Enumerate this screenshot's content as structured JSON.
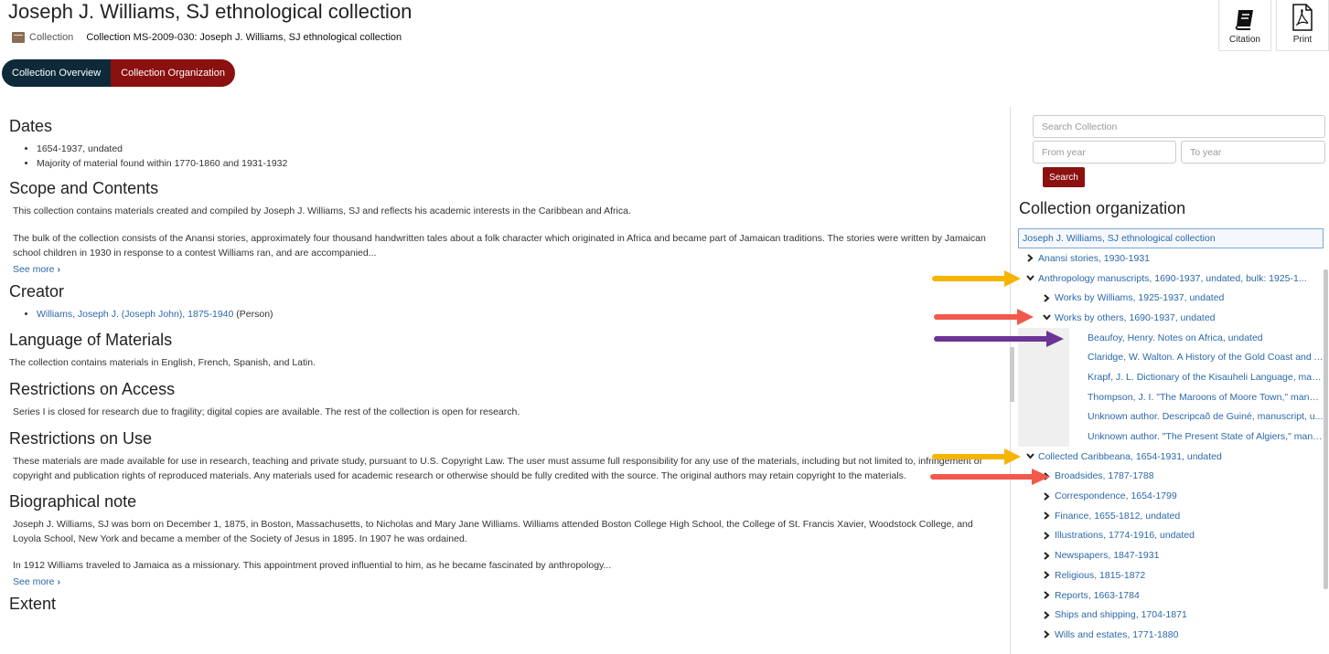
{
  "header": {
    "title": "Joseph J. Williams, SJ ethnological collection",
    "breadcrumb_type": "Collection",
    "breadcrumb_id": "Collection MS-2009-030: Joseph J. Williams, SJ ethnological collection",
    "citation_label": "Citation",
    "print_label": "Print"
  },
  "tabs": [
    "Collection Overview",
    "Collection Organization"
  ],
  "main": {
    "dates_h": "Dates",
    "dates": [
      "1654-1937, undated",
      "Majority of material found within 1770-1860 and 1931-1932"
    ],
    "scope_h": "Scope and Contents",
    "scope_p1": "This collection contains materials created and compiled by Joseph J. Williams, SJ and reflects his academic interests in the Caribbean and Africa.",
    "scope_p2": "The bulk of the collection consists of the Anansi stories, approximately four thousand handwritten tales about a folk character which originated in Africa and became part of Jamaican traditions. The stories were written by Jamaican school children in 1930 in response to a contest Williams ran, and are accompanied...",
    "see_more": "See more",
    "creator_h": "Creator",
    "creator_link": "Williams, Joseph J. (Joseph John), 1875-1940",
    "creator_role": "(Person)",
    "lang_h": "Language of Materials",
    "lang_p": "The collection contains materials in English, French, Spanish, and Latin.",
    "access_h": "Restrictions on Access",
    "access_p": "Series I is closed for research due to fragility; digital copies are available. The rest of the collection is open for research.",
    "use_h": "Restrictions on Use",
    "use_p": "These materials are made available for use in research, teaching and private study, pursuant to U.S. Copyright Law. The user must assume full responsibility for any use of the materials, including but not limited to, infringement of copyright and publication rights of reproduced materials. Any materials used for academic research or otherwise should be fully credited with the source. The original authors may retain copyright to the materials.",
    "bio_h": "Biographical note",
    "bio_p1": "Joseph J. Williams, SJ was born on December 1, 1875, in Boston, Massachusetts, to Nicholas and Mary Jane Williams. Williams attended Boston College High School, the College of St. Francis Xavier, Woodstock College, and Loyola School, New York and became a member of the Society of Jesus in 1895. In 1907 he was ordained.",
    "bio_p2": "In 1912 Williams traveled to Jamaica as a missionary. This appointment proved influential to him, as he became fascinated by anthropology...",
    "extent_h": "Extent"
  },
  "sidebar": {
    "search_placeholder": "Search Collection",
    "from_placeholder": "From year",
    "to_placeholder": "To year",
    "search_button": "Search",
    "org_heading": "Collection organization",
    "tree": [
      {
        "label": "Joseph J. Williams, SJ ethnological collection",
        "level": 0,
        "chev": ""
      },
      {
        "label": "Anansi stories, 1930-1931",
        "level": 1,
        "chev": "›"
      },
      {
        "label": "Anthropology manuscripts, 1690-1937, undated, bulk: 1925-1...",
        "level": 1,
        "chev": "⌄"
      },
      {
        "label": "Works by Williams, 1925-1937, undated",
        "level": 2,
        "chev": "›"
      },
      {
        "label": "Works by others, 1690-1937, undated",
        "level": 2,
        "chev": "⌄"
      },
      {
        "label": "Beaufoy, Henry. Notes on Africa, undated",
        "level": 3,
        "chev": ""
      },
      {
        "label": "Claridge, W. Walton. A History of the Gold Coast and A...",
        "level": 3,
        "chev": ""
      },
      {
        "label": "Krapf, J. L. Dictionary of the Kisauheli Language, manu...",
        "level": 3,
        "chev": ""
      },
      {
        "label": "Thompson, J. I. \"The Maroons of Moore Town,\" manus...",
        "level": 3,
        "chev": ""
      },
      {
        "label": "Unknown author. Descripcaõ de Guiné, manuscript, u...",
        "level": 3,
        "chev": ""
      },
      {
        "label": "Unknown author. \"The Present State of Algiers,\" manu...",
        "level": 3,
        "chev": ""
      },
      {
        "label": "Collected Caribbeana, 1654-1931, undated",
        "level": 1,
        "chev": "⌄"
      },
      {
        "label": "Broadsides, 1787-1788",
        "level": 2,
        "chev": "›"
      },
      {
        "label": "Correspondence, 1654-1799",
        "level": 2,
        "chev": "›"
      },
      {
        "label": "Finance, 1655-1812, undated",
        "level": 2,
        "chev": "›"
      },
      {
        "label": "Illustrations, 1774-1916, undated",
        "level": 2,
        "chev": "›"
      },
      {
        "label": "Newspapers, 1847-1931",
        "level": 2,
        "chev": "›"
      },
      {
        "label": "Religious, 1815-1872",
        "level": 2,
        "chev": "›"
      },
      {
        "label": "Reports, 1663-1784",
        "level": 2,
        "chev": "›"
      },
      {
        "label": "Ships and shipping, 1704-1871",
        "level": 2,
        "chev": "›"
      },
      {
        "label": "Wills and estates, 1771-1880",
        "level": 2,
        "chev": "›"
      }
    ]
  },
  "annotation_arrows": [
    {
      "color": "#f5b400",
      "target": "Anthropology manuscripts"
    },
    {
      "color": "#f2594b",
      "target": "Works by others"
    },
    {
      "color": "#6c3496",
      "target": "Beaufoy, Henry"
    },
    {
      "color": "#f5b400",
      "target": "Collected Caribbeana"
    },
    {
      "color": "#f2594b",
      "target": "Broadsides"
    }
  ]
}
